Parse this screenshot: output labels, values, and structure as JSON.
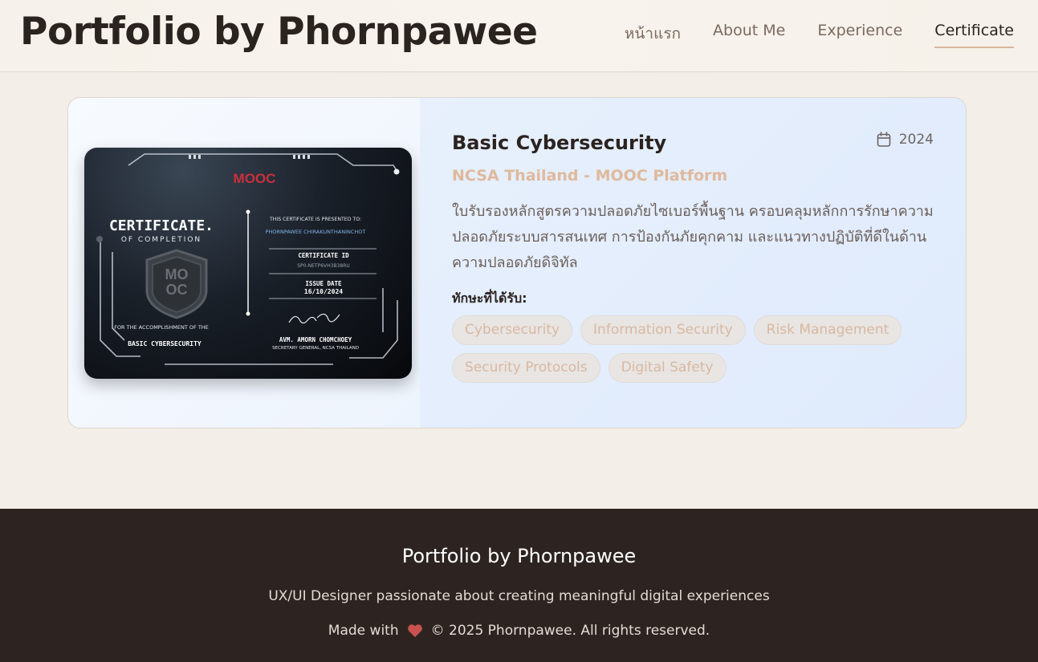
{
  "header": {
    "site_title": "Portfolio by Phornpawee",
    "nav": [
      {
        "label": "หน้าแรก",
        "active": false
      },
      {
        "label": "About Me",
        "active": false
      },
      {
        "label": "Experience",
        "active": false
      },
      {
        "label": "Certificate",
        "active": true
      }
    ]
  },
  "certificate": {
    "title": "Basic Cybersecurity",
    "year": "2024",
    "issuer": "NCSA Thailand - MOOC Platform",
    "description": "ใบรับรองหลักสูตรความปลอดภัยไซเบอร์พื้นฐาน ครอบคลุมหลักการรักษาความปลอดภัยระบบสารสนเทศ การป้องกันภัยคุกคาม และแนวทางปฏิบัติที่ดีในด้านความปลอดภัยดิจิทัล",
    "skills_label": "ทักษะที่ได้รับ:",
    "skills": [
      "Cybersecurity",
      "Information Security",
      "Risk Management",
      "Security Protocols",
      "Digital Safety"
    ],
    "image": {
      "logo": "MOOC",
      "heading": "CERTIFICATE.",
      "subheading": "OF COMPLETION",
      "presented_to_label": "THIS CERTIFICATE IS PRESENTED TO:",
      "recipient": "PHORNPAWEE CHIRAKUNTHANINCHOT",
      "id_label": "CERTIFICATE ID",
      "id_value": "SP0-NETP6VH3B38RU",
      "issue_label": "ISSUE DATE",
      "issue_date": "16/10/2024",
      "accomplishment_label": "FOR THE ACCOMPLISHMENT OF THE",
      "course": "BASIC CYBERSECURITY",
      "signer": "AVM. AMORN CHOMCHOEY",
      "signer_title": "SECRETARY GENERAL, NCSA THAILAND",
      "badge_top": "MO",
      "badge_bottom": "OC"
    }
  },
  "footer": {
    "title": "Portfolio by Phornpawee",
    "tagline": "UX/UI Designer passionate about creating meaningful digital experiences",
    "made_with": "Made with",
    "copyright": "© 2025 Phornpawee. All rights reserved."
  },
  "colors": {
    "accent": "#dfb99c",
    "footer_bg": "#2d2421",
    "heart": "#c8524f"
  },
  "icons": [
    "calendar-icon",
    "heart-icon"
  ]
}
